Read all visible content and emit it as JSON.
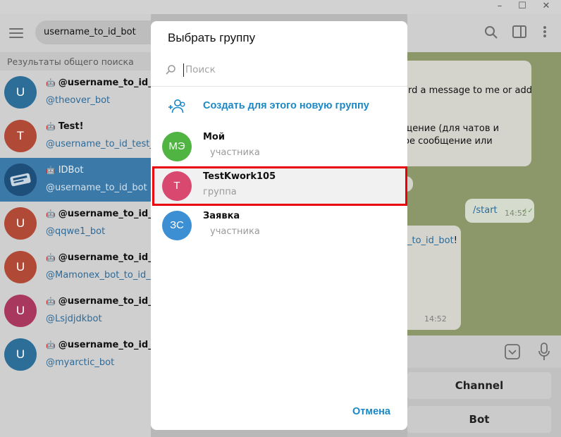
{
  "window": {
    "minimize_icon": "minimize-icon",
    "maximize_icon": "maximize-icon",
    "close_icon": "close-icon"
  },
  "left": {
    "search_value": "username_to_id_bot",
    "section_title": "Результаты общего поиска",
    "chats": [
      {
        "initial": "U",
        "color": "#2c6e98",
        "title": "@username_to_id_bot",
        "sub": "@theover_bot"
      },
      {
        "initial": "T",
        "color": "#b04a37",
        "title": "Test!",
        "sub": "@username_to_id_test_bot"
      },
      {
        "initial": "",
        "color": "#1e4f7a",
        "title": "IDBot",
        "sub": "@username_to_id_bot"
      },
      {
        "initial": "U",
        "color": "#b04a37",
        "title": "@username_to_id_bot",
        "sub": "@qqwe1_bot"
      },
      {
        "initial": "U",
        "color": "#b04a37",
        "title": "@username_to_id_bot",
        "sub": "@Mamonex_bot_to_id_bot"
      },
      {
        "initial": "U",
        "color": "#a9385e",
        "title": "@username_to_id_bot",
        "sub": "@Lsjdjdkbot"
      },
      {
        "initial": "U",
        "color": "#2c6e98",
        "title": "@username_to_id_bot",
        "sub": "@myarctic_bot"
      }
    ]
  },
  "chat": {
    "msg1_lines": [
      "ard a message to me or add"
    ],
    "msg1_lines2": [
      "щение (для чатов и",
      "ое сообщение или"
    ],
    "outgoing_text": "/start",
    "outgoing_time": "14:52",
    "link_text": "_to_id_bot",
    "link_suffix": "!",
    "incoming_time": "14:52",
    "keyboard": {
      "channel": "Channel",
      "bot": "Bot"
    }
  },
  "modal": {
    "title": "Выбрать группу",
    "search_placeholder": "Поиск",
    "create_label": "Создать для этого новую группу",
    "groups": [
      {
        "initials": "МЭ",
        "color": "#4fb442",
        "name": "Мой",
        "sub": "участника"
      },
      {
        "initials": "T",
        "color": "#d9486e",
        "name": "TestKwork105",
        "sub": "группа",
        "selected": true
      },
      {
        "initials": "ЗС",
        "color": "#3d8fd3",
        "name": "Заявка",
        "sub": "участника"
      }
    ],
    "cancel_label": "Отмена",
    "highlight_color": "#e8000b"
  }
}
